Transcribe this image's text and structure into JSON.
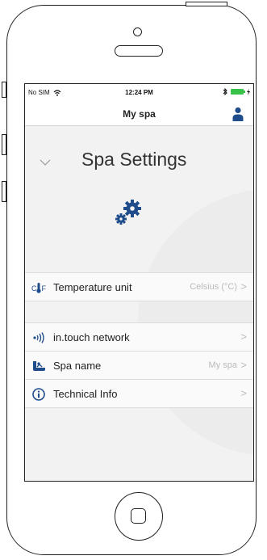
{
  "status_bar": {
    "carrier": "No SIM",
    "time": "12:24 PM"
  },
  "nav": {
    "title": "My spa"
  },
  "section": {
    "title": "Spa Settings"
  },
  "rows": [
    {
      "label": "Temperature unit",
      "value": "Celsius (°C)"
    },
    {
      "label": "in.touch network",
      "value": ""
    },
    {
      "label": "Spa name",
      "value": "My spa"
    },
    {
      "label": "Technical Info",
      "value": ""
    }
  ],
  "temp_icon": {
    "c": "C",
    "f": "F"
  },
  "arrow_glyph": ">",
  "colors": {
    "accent": "#1f4c8a",
    "battery": "#39c24a",
    "muted": "#bbbbbb",
    "background": "#f2f2f2"
  }
}
